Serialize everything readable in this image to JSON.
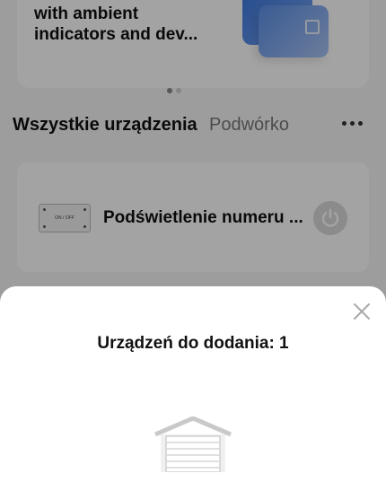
{
  "promo": {
    "line_partial": "with ambient",
    "line_1": "with ambient",
    "line_2": "indicators and dev...",
    "slides_total": 2,
    "slide_active": 1
  },
  "section": {
    "title_all": "Wszystkie urządzenia",
    "title_room": "Podwórko"
  },
  "device": {
    "name": "Podświetlenie numeru ...",
    "thumb_label": "ON / OFF"
  },
  "sheet": {
    "title": "Urządzeń do dodania: 1"
  },
  "icons": {
    "more": "more-horizontal-icon",
    "power": "power-icon",
    "close": "close-icon",
    "garage": "garage-icon"
  },
  "colors": {
    "overlay": "#5c5c5c",
    "sheet_bg": "#ffffff",
    "power_bg": "#d9d9d9"
  }
}
